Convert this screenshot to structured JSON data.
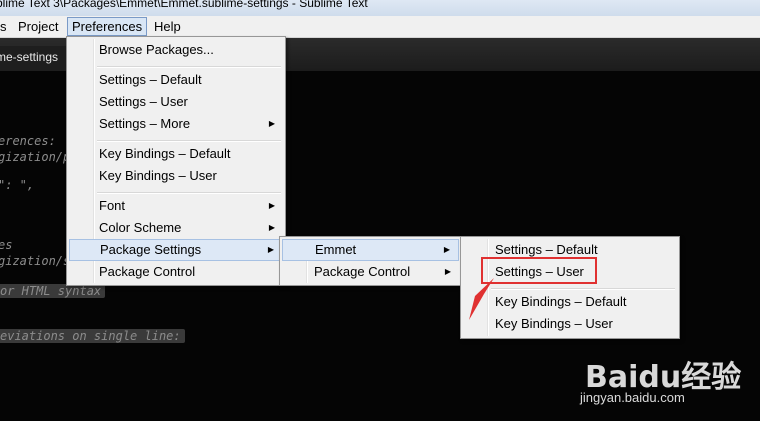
{
  "window": {
    "title": "blime Text 3\\Packages\\Emmet\\Emmet.sublime-settings - Sublime Text"
  },
  "menubar": {
    "items": [
      {
        "label": "s"
      },
      {
        "label": "Project"
      },
      {
        "label": "Preferences"
      },
      {
        "label": "Help"
      }
    ]
  },
  "tab": {
    "label": "me-settings"
  },
  "editor": {
    "lines": [
      "erences:",
      "gization/p",
      "\": \",",
      "es",
      "gization/s",
      "or HTML syntax",
      "eviations on single line:"
    ]
  },
  "preferences_menu": {
    "items": [
      {
        "label": "Browse Packages...",
        "submenu": false
      },
      {
        "label": "Settings – Default",
        "submenu": false
      },
      {
        "label": "Settings – User",
        "submenu": false
      },
      {
        "label": "Settings – More",
        "submenu": true
      },
      {
        "label": "Key Bindings – Default",
        "submenu": false
      },
      {
        "label": "Key Bindings – User",
        "submenu": false
      },
      {
        "label": "Font",
        "submenu": true
      },
      {
        "label": "Color Scheme",
        "submenu": true
      },
      {
        "label": "Package Settings",
        "submenu": true
      },
      {
        "label": "Package Control",
        "submenu": false
      }
    ]
  },
  "package_settings_menu": {
    "items": [
      {
        "label": "Emmet",
        "submenu": true
      },
      {
        "label": "Package Control",
        "submenu": true
      }
    ]
  },
  "emmet_menu": {
    "items": [
      {
        "label": "Settings – Default"
      },
      {
        "label": "Settings – User"
      },
      {
        "label": "Key Bindings – Default"
      },
      {
        "label": "Key Bindings – User"
      }
    ]
  },
  "watermark": {
    "brand": "Baidu经验",
    "url": "jingyan.baidu.com"
  },
  "colors": {
    "highlight_red": "#e03131",
    "menu_bg": "#f0f0f0",
    "editor_bg": "#050505"
  }
}
